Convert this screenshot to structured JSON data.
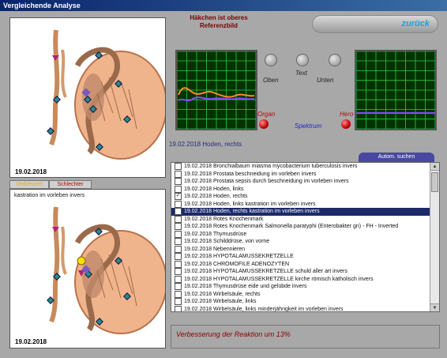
{
  "window": {
    "title": "Vergleichende Analyse"
  },
  "left_top": {
    "date": "19.02.2018"
  },
  "tabs": {
    "verbessert": "Verbessert",
    "schlechter": "Schlechter"
  },
  "left_bottom": {
    "caption": "kastration im vorleben invers",
    "date": "19.02.2018"
  },
  "header": {
    "line1": "Häkchen ist oberes",
    "line2": "Referenzbild"
  },
  "zurueck_label": "zurück",
  "controls": {
    "oben": "Oben",
    "text": "Text",
    "unten": "Unten"
  },
  "indicators": {
    "organ": "Organ",
    "spektrum": "Spektrum",
    "hero": "Hero"
  },
  "status_top": "19.02.2018 Hoden, rechts",
  "auto_search_label": "Autom. suchen",
  "list_items": [
    {
      "text": "19.02.2018 Bronchialbaum  miasma mycobacterium tuberculosis invers",
      "checked": false,
      "selected": false
    },
    {
      "text": "19.02.2018 Prostata  beschneidung im vorleben invers",
      "checked": false,
      "selected": false
    },
    {
      "text": "19.02.2018 Prostata  sepsis durch beschneidung im vorleben invers",
      "checked": false,
      "selected": false
    },
    {
      "text": "19.02.2018 Hoden, links",
      "checked": false,
      "selected": false
    },
    {
      "text": "19.02.2018 Hoden, rechts",
      "checked": true,
      "selected": false
    },
    {
      "text": "19.02.2018 Hoden, links  kastration im vorleben invers",
      "checked": false,
      "selected": false
    },
    {
      "text": "19.02.2018 Hoden, rechts  kastration im vorleben invers",
      "checked": false,
      "selected": true
    },
    {
      "text": "19.02.2018 Rotes Knochenmark",
      "checked": false,
      "selected": false
    },
    {
      "text": "19.02.2018 Rotes Knochenmark  Salmonella paratyphi (Enterobakter gn) - FH - Inverted",
      "checked": false,
      "selected": false
    },
    {
      "text": "19.02.2018 Thymusdrüse",
      "checked": false,
      "selected": false
    },
    {
      "text": "19.02.2018 Schilddrüse, von vorne",
      "checked": false,
      "selected": false
    },
    {
      "text": "19.02.2018 Nebennieren",
      "checked": false,
      "selected": false
    },
    {
      "text": "19.02.2018 HYPOTALAMUSSEKRETZELLE",
      "checked": false,
      "selected": false
    },
    {
      "text": "19.02.2018 CHROMOFILE ADENOZYTEN",
      "checked": false,
      "selected": false
    },
    {
      "text": "19.02.2018 HYPOTALAMUSSEKRETZELLE  schuld aller art invers",
      "checked": false,
      "selected": false
    },
    {
      "text": "19.02.2018 HYPOTALAMUSSEKRETZELLE  kirche römisch katholisch invers",
      "checked": false,
      "selected": false
    },
    {
      "text": "19.02.2018 Thymusdrüse  eide und gelübde invers",
      "checked": false,
      "selected": false
    },
    {
      "text": "19.02.2018 Wirbelsäule, rechts",
      "checked": false,
      "selected": false
    },
    {
      "text": "19.02.2018 Wirbelsäule, links",
      "checked": false,
      "selected": false
    },
    {
      "text": "19.02.2018 Wirbelsäule, links  minderjährigkeit im vorleben invers",
      "checked": false,
      "selected": false
    }
  ],
  "message": "Verbesserung der Reaktion um 13%",
  "colors": {
    "accent_blue": "#1aa3d8",
    "list_selection": "#1c2a6a",
    "message": "#8a0000",
    "grid_bg": "#003300"
  }
}
